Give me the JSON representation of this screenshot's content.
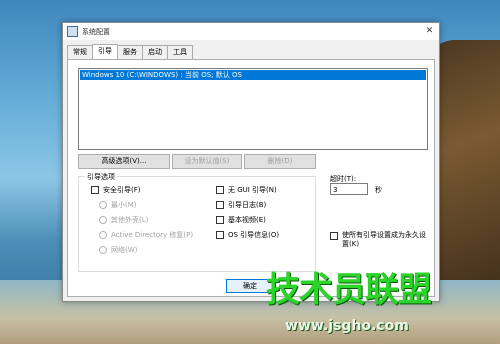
{
  "window": {
    "title": "系统配置"
  },
  "tabs": [
    "常规",
    "引导",
    "服务",
    "启动",
    "工具"
  ],
  "os_list": {
    "entry": "Windows 10 (C:\\WINDOWS) : 当前 OS; 默认 OS"
  },
  "buttons": {
    "advanced": "高级选项(V)...",
    "set_default": "设为默认值(S)",
    "delete": "删除(D)",
    "ok": "确定"
  },
  "boot_options": {
    "title": "引导选项",
    "safe_boot": "安全引导(F)",
    "minimal": "最小(M)",
    "alternate_shell": "其他外壳(L)",
    "active_directory": "Active Directory 修复(P)",
    "network": "网络(W)",
    "no_gui": "无 GUI 引导(N)",
    "boot_log": "引导日志(B)",
    "base_video": "基本视频(E)",
    "os_boot_info": "OS 引导信息(O)"
  },
  "timeout": {
    "label": "超时(T):",
    "value": "3",
    "unit": "秒"
  },
  "make_permanent": "使所有引导设置成为永久设置(K)",
  "watermark": {
    "logo": "技术员联盟",
    "url": "www.jsgho.com"
  }
}
